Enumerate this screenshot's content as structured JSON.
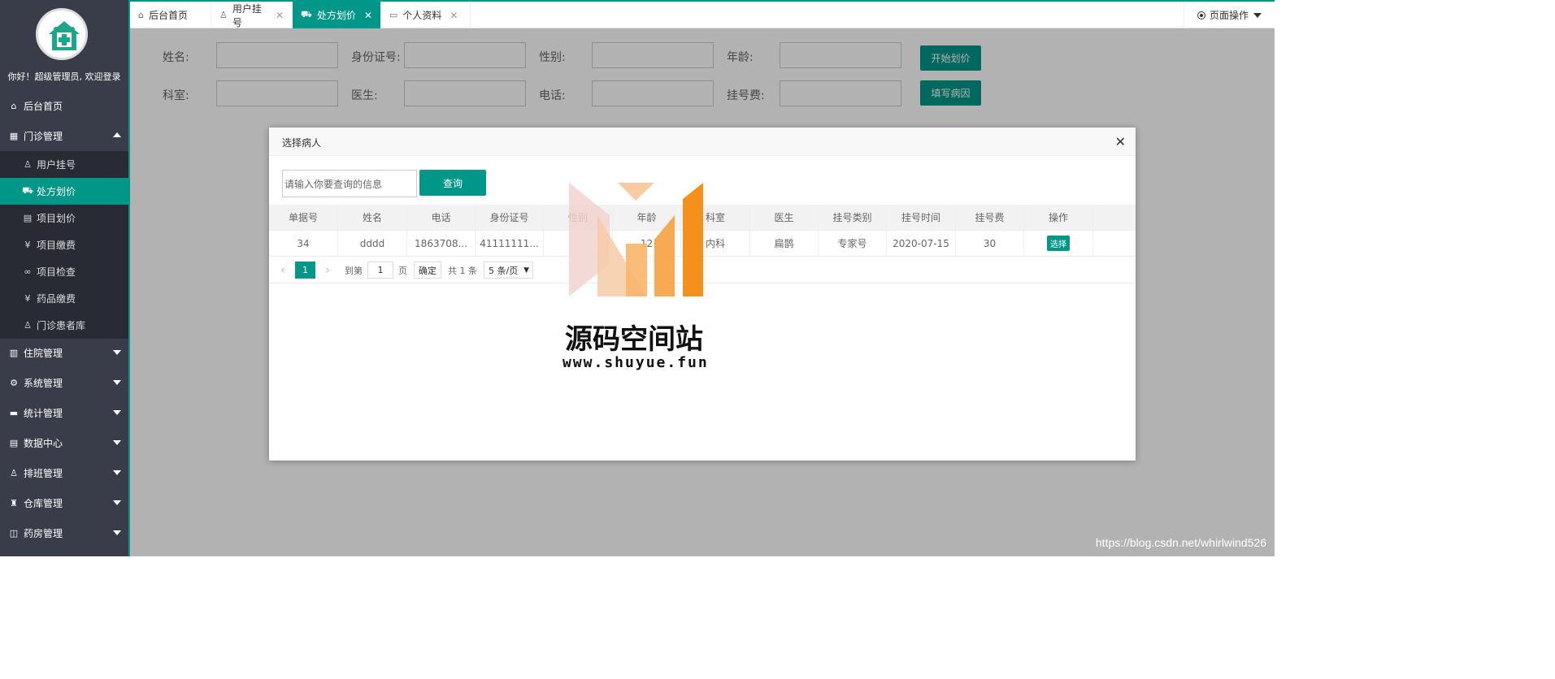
{
  "sidebar": {
    "welcome": "你好！超级管理员, 欢迎登录",
    "home": "后台首页",
    "outpatient": "门诊管理",
    "sub_items": [
      {
        "label": "用户挂号",
        "icon": "user-icon"
      },
      {
        "label": "处方划价",
        "icon": "cart-icon"
      },
      {
        "label": "项目划价",
        "icon": "document-icon"
      },
      {
        "label": "项目缴费",
        "icon": "yen-icon"
      },
      {
        "label": "项目检查",
        "icon": "link-icon"
      },
      {
        "label": "药品缴费",
        "icon": "yen-icon"
      },
      {
        "label": "门诊患者库",
        "icon": "person-icon"
      }
    ],
    "groups": [
      {
        "label": "住院管理",
        "icon": "building-icon"
      },
      {
        "label": "系统管理",
        "icon": "gear-icon"
      },
      {
        "label": "统计管理",
        "icon": "chart-icon"
      },
      {
        "label": "数据中心",
        "icon": "document-icon"
      },
      {
        "label": "排班管理",
        "icon": "user-icon"
      },
      {
        "label": "仓库管理",
        "icon": "warehouse-icon"
      },
      {
        "label": "药房管理",
        "icon": "book-icon"
      }
    ]
  },
  "tabs": [
    {
      "label": "后台首页",
      "icon": "home-icon",
      "closable": false
    },
    {
      "label": "用户挂号",
      "icon": "user-icon",
      "closable": true
    },
    {
      "label": "处方划价",
      "icon": "cart-icon",
      "closable": true,
      "active": true
    },
    {
      "label": "个人资料",
      "icon": "id-card-icon",
      "closable": true
    }
  ],
  "page_ops": "页面操作",
  "form": {
    "name": "姓名:",
    "id_card": "身份证号:",
    "gender": "性别:",
    "age": "年龄:",
    "start_btn": "开始划价",
    "dept": "科室:",
    "doctor": "医生:",
    "phone": "电话:",
    "fee": "挂号费:",
    "cause_btn": "填写病因"
  },
  "modal": {
    "title": "选择病人",
    "search_placeholder": "请输入你要查询的信息",
    "search_btn": "查询",
    "columns": [
      "单据号",
      "姓名",
      "电话",
      "身份证号",
      "性别",
      "年龄",
      "科室",
      "医生",
      "挂号类别",
      "挂号时间",
      "挂号费",
      "操作"
    ],
    "rows": [
      [
        "34",
        "dddd",
        "1863708...",
        "41111111...",
        "",
        "12",
        "内科",
        "扁鹊",
        "专家号",
        "2020-07-15",
        "30",
        "选择"
      ]
    ],
    "pager": {
      "page": "1",
      "goto_label": "到第",
      "goto_value": "1",
      "page_unit": "页",
      "ok": "确定",
      "total": "共 1 条",
      "page_size": "5 条/页"
    }
  },
  "watermark": {
    "title": "源码空间站",
    "url": "www.shuyue.fun",
    "csdn": "https://blog.csdn.net/whirlwind526"
  },
  "colors": {
    "accent": "#009688",
    "sidebar": "#393d49",
    "sidebar_sub": "#282b33"
  }
}
